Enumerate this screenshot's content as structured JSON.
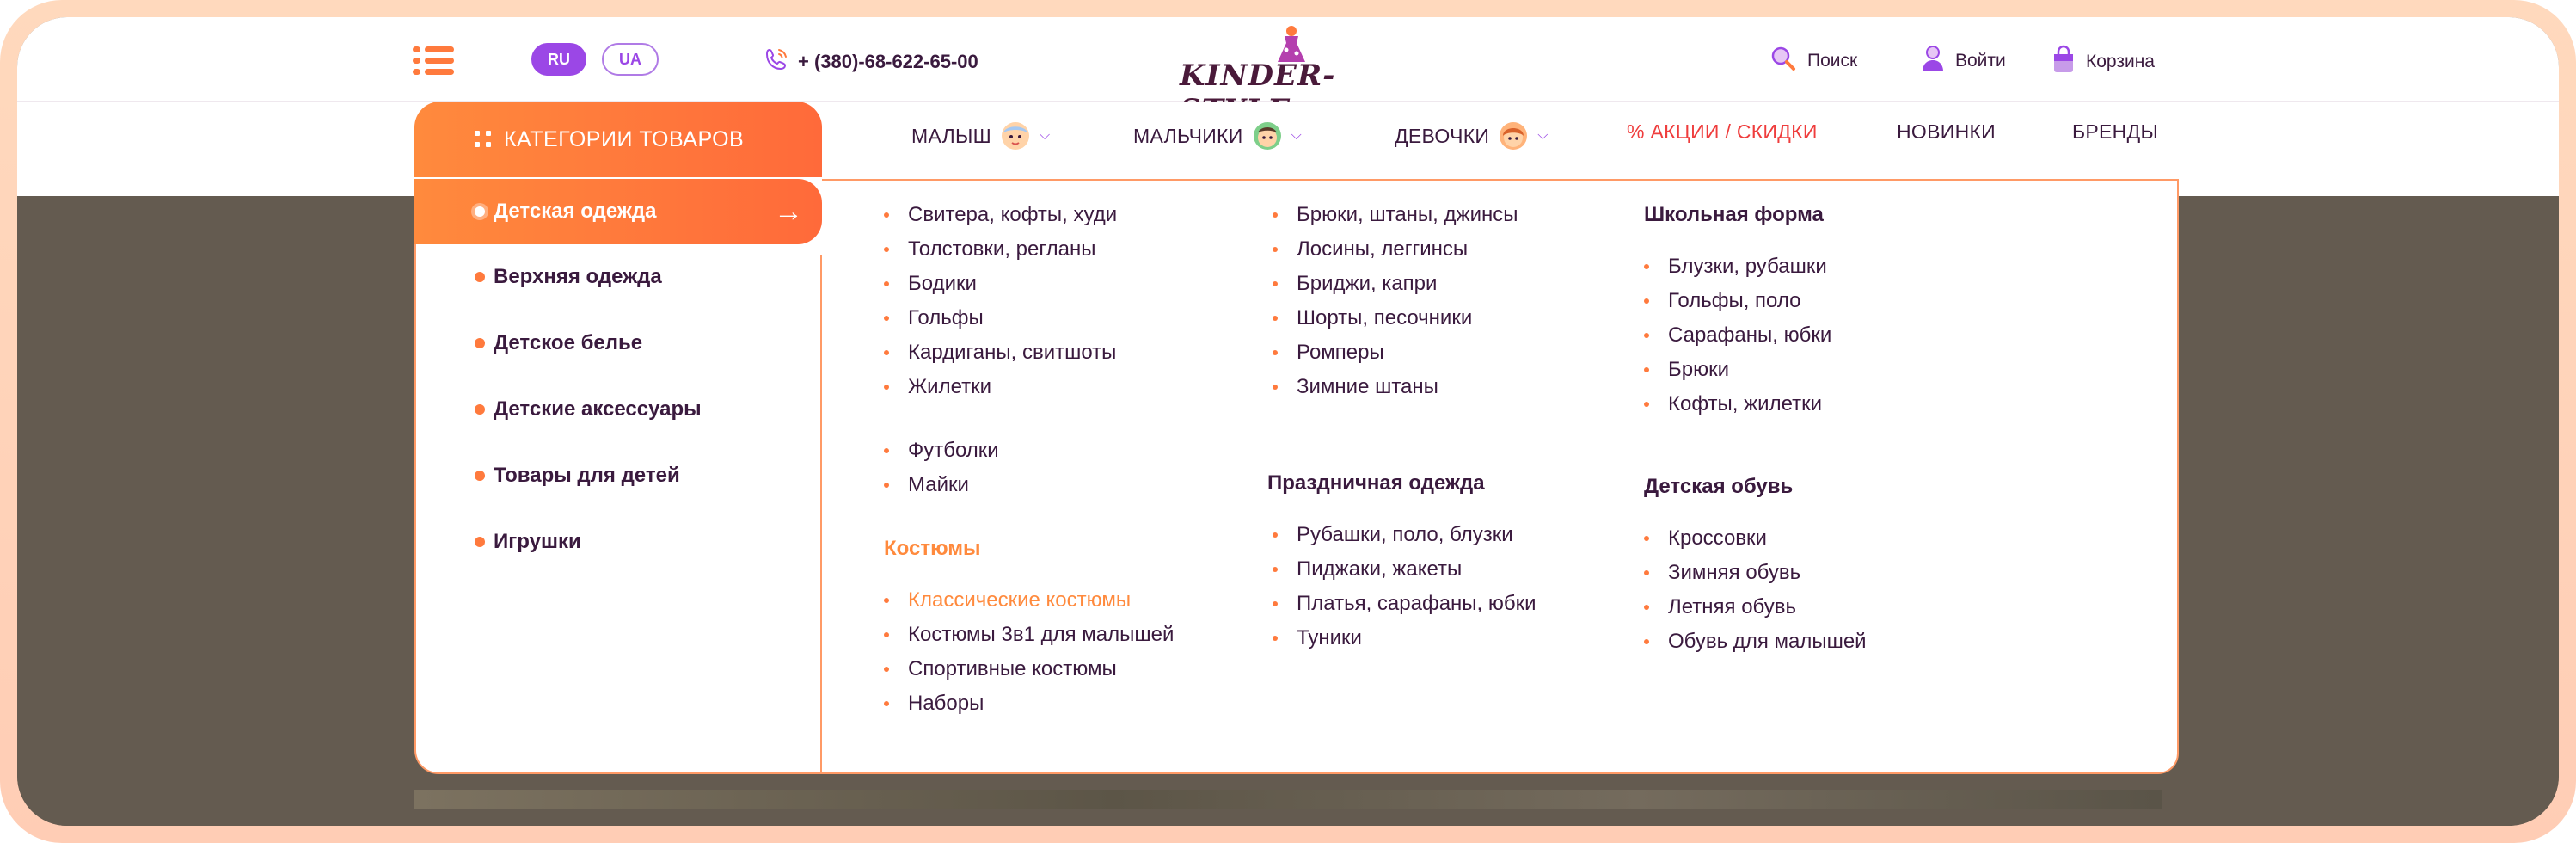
{
  "header": {
    "languages": [
      {
        "code": "RU",
        "active": true
      },
      {
        "code": "UA",
        "active": false
      }
    ],
    "phone": "+ (380)-68-622-65-00",
    "logo_text": "KINDER-STYLE",
    "search_label": "Поиск",
    "login_label": "Войти",
    "cart_label": "Корзина"
  },
  "nav": {
    "categories_button": "КАТЕГОРИИ ТОВАРОВ",
    "items": [
      {
        "label": "МАЛЫШ"
      },
      {
        "label": "МАЛЬЧИКИ"
      },
      {
        "label": "ДЕВОЧКИ"
      },
      {
        "label": "% АКЦИИ / СКИДКИ"
      },
      {
        "label": "НОВИНКИ"
      },
      {
        "label": "БРЕНДЫ"
      }
    ]
  },
  "categories": [
    {
      "label": "Детская одежда",
      "active": true
    },
    {
      "label": "Верхняя одежда"
    },
    {
      "label": "Детское белье"
    },
    {
      "label": "Детские аксессуары"
    },
    {
      "label": "Товары для детей"
    },
    {
      "label": "Игрушки"
    }
  ],
  "submenu": {
    "col1": {
      "group1": [
        "Свитера, кофты, худи",
        "Толстовки, регланы",
        "Бодики",
        "Гольфы",
        "Кардиганы, свитшоты",
        "Жилетки"
      ],
      "group2": [
        "Футболки",
        "Майки"
      ],
      "costumes_heading": "Костюмы",
      "costumes": [
        "Классические костюмы",
        "Костюмы 3в1 для малышей",
        "Спортивные костюмы",
        "Наборы"
      ]
    },
    "col2": {
      "group1": [
        "Брюки, штаны, джинсы",
        "Лосины, леггинсы",
        "Бриджи, капри",
        "Шорты, песочники",
        "Ромперы",
        "Зимние штаны"
      ],
      "holiday_heading": "Праздничная одежда",
      "holiday": [
        "Рубашки, поло, блузки",
        "Пиджаки, жакеты",
        "Платья, сарафаны, юбки",
        "Туники"
      ]
    },
    "col3": {
      "school_heading": "Школьная форма",
      "school": [
        "Блузки, рубашки",
        "Гольфы, поло",
        "Сарафаны, юбки",
        "Брюки",
        "Кофты, жилетки"
      ],
      "shoes_heading": "Детская обувь",
      "shoes": [
        "Кроссовки",
        "Зимняя обувь",
        "Летняя обувь",
        "Обувь для малышей"
      ]
    }
  },
  "colors": {
    "accent": "#ff7a3d",
    "purple": "#9b47e6",
    "text": "#3a1a3e",
    "sale": "#ef3d3d"
  }
}
